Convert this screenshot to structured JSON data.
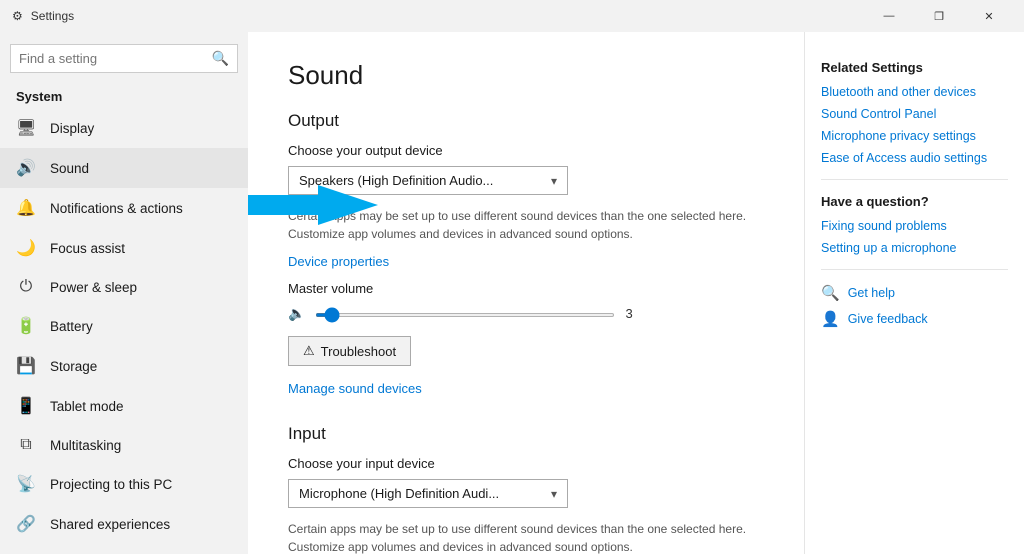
{
  "titlebar": {
    "icon": "⚙",
    "title": "Settings",
    "minimize": "—",
    "maximize": "❐",
    "close": "✕"
  },
  "sidebar": {
    "search_placeholder": "Find a setting",
    "search_icon": "🔍",
    "section_label": "System",
    "items": [
      {
        "id": "display",
        "icon": "🖥",
        "label": "Display"
      },
      {
        "id": "sound",
        "icon": "🔊",
        "label": "Sound",
        "active": true
      },
      {
        "id": "notifications",
        "icon": "🔔",
        "label": "Notifications & actions"
      },
      {
        "id": "focus",
        "icon": "🌙",
        "label": "Focus assist"
      },
      {
        "id": "power",
        "icon": "⏻",
        "label": "Power & sleep"
      },
      {
        "id": "battery",
        "icon": "🔋",
        "label": "Battery"
      },
      {
        "id": "storage",
        "icon": "💾",
        "label": "Storage"
      },
      {
        "id": "tablet",
        "icon": "📱",
        "label": "Tablet mode"
      },
      {
        "id": "multitasking",
        "icon": "⧉",
        "label": "Multitasking"
      },
      {
        "id": "projecting",
        "icon": "📡",
        "label": "Projecting to this PC"
      },
      {
        "id": "shared",
        "icon": "🔗",
        "label": "Shared experiences"
      }
    ]
  },
  "content": {
    "title": "Sound",
    "output_heading": "Output",
    "output_device_label": "Choose your output device",
    "output_device_value": "Speakers (High Definition Audio...",
    "output_desc": "Certain apps may be set up to use different sound devices than the one selected here. Customize app volumes and devices in advanced sound options.",
    "device_properties_link": "Device properties",
    "master_volume_label": "Master volume",
    "master_volume_value": "3",
    "troubleshoot_label": "Troubleshoot",
    "manage_devices_link": "Manage sound devices",
    "input_heading": "Input",
    "input_device_label": "Choose your input device",
    "input_device_value": "Microphone (High Definition Audi...",
    "input_desc": "Certain apps may be set up to use different sound devices than the one selected here. Customize app volumes and devices in advanced sound options."
  },
  "right_panel": {
    "related_title": "Related Settings",
    "links": [
      "Bluetooth and other devices",
      "Sound Control Panel",
      "Microphone privacy settings",
      "Ease of Access audio settings"
    ],
    "question_title": "Have a question?",
    "question_links": [
      "Fixing sound problems",
      "Setting up a microphone"
    ],
    "help_label": "Get help",
    "feedback_label": "Give feedback"
  }
}
